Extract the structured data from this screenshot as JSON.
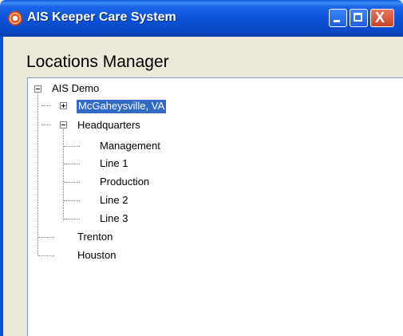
{
  "window": {
    "title": "AIS Keeper Care System",
    "close_glyph": "X",
    "accent_color": "#0a52d8",
    "selection_color": "#316ac5"
  },
  "page_title": "Locations Manager",
  "tree": {
    "root": {
      "label": "AIS Demo",
      "expanded": true
    },
    "children": [
      {
        "label": "McGaheysville, VA",
        "expanded": false,
        "selected": true
      },
      {
        "label": "Headquarters",
        "expanded": true,
        "children": [
          {
            "label": "Management"
          },
          {
            "label": "Line 1"
          },
          {
            "label": "Production"
          },
          {
            "label": "Line 2"
          },
          {
            "label": "Line 3"
          }
        ]
      },
      {
        "label": "Trenton"
      },
      {
        "label": "Houston"
      }
    ]
  }
}
